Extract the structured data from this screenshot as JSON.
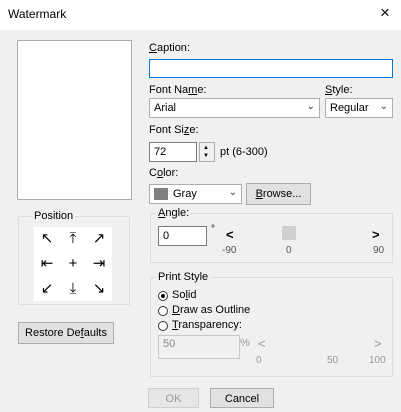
{
  "window": {
    "title": "Watermark",
    "close_glyph": "×"
  },
  "caption": {
    "label_pre": "",
    "label_key": "C",
    "label_post": "aption:",
    "value": ""
  },
  "font_name": {
    "label_pre": "Font Na",
    "label_key": "m",
    "label_post": "e:",
    "value": "Arial"
  },
  "style": {
    "label_pre": "",
    "label_key": "S",
    "label_post": "tyle:",
    "value": "Regular"
  },
  "font_size": {
    "label_pre": "Font Si",
    "label_key": "z",
    "label_post": "e:",
    "value": "72",
    "unit": "pt (6-300)"
  },
  "color": {
    "label_pre": "C",
    "label_key": "o",
    "label_post": "lor:",
    "value": "Gray",
    "swatch": "#808080"
  },
  "browse": {
    "label_pre": "",
    "label_key": "B",
    "label_post": "rowse..."
  },
  "position": {
    "legend": "Position",
    "arrows": [
      "↖",
      "⤒",
      "↗",
      "⇤",
      "+",
      "⇥",
      "↙",
      "⤓",
      "↘"
    ]
  },
  "restore": {
    "label_pre": "Restore De",
    "label_key": "f",
    "label_post": "aults"
  },
  "angle": {
    "label_pre": "",
    "label_key": "A",
    "label_post": "ngle:",
    "value": "0",
    "degree": "°",
    "left_arrow": "<",
    "right_arrow": ">",
    "min": "-90",
    "mid": "0",
    "max": "90",
    "level": 0
  },
  "print_style": {
    "legend": "Print Style",
    "solid": {
      "label_pre": "So",
      "label_key": "l",
      "label_post": "id",
      "selected": true
    },
    "outline": {
      "label_pre": "",
      "label_key": "D",
      "label_post": "raw as Outline",
      "selected": false
    },
    "transparency": {
      "label_pre": "",
      "label_key": "T",
      "label_post": "ransparency:",
      "selected": false
    },
    "trans_value": "50",
    "trans_unit": "%",
    "left_arrow": "<",
    "right_arrow": ">",
    "min": "0",
    "mid": "50",
    "max": "100"
  },
  "buttons": {
    "ok": "OK",
    "cancel": "Cancel"
  },
  "icons": {
    "chevron": "chevron-down-icon",
    "close": "close-icon"
  }
}
